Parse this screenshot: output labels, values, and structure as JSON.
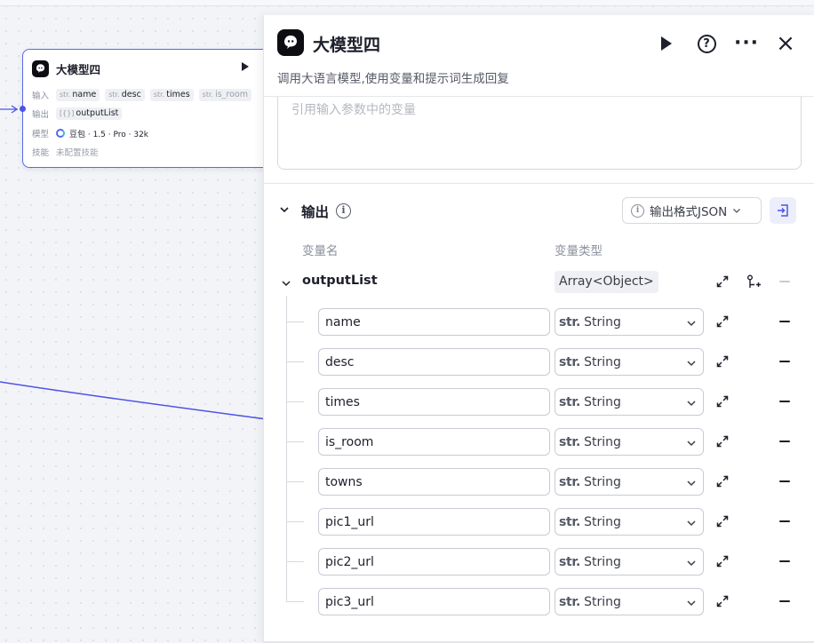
{
  "node": {
    "title": "大模型四",
    "labels": {
      "input": "输入",
      "output": "输出",
      "model": "模型",
      "skill": "技能"
    },
    "inputs": [
      {
        "prefix": "str.",
        "name": "name"
      },
      {
        "prefix": "str.",
        "name": "desc"
      },
      {
        "prefix": "str.",
        "name": "times"
      },
      {
        "prefix": "str.",
        "name": "is_room"
      }
    ],
    "output": {
      "prefix": "[{}]",
      "name": "outputList"
    },
    "model": "豆包 · 1.5 · Pro · 32k",
    "skill": "未配置技能"
  },
  "panel": {
    "title": "大模型四",
    "description": "调用大语言模型,使用变量和提示词生成回复",
    "prompt_placeholder": "引用输入参数中的变量",
    "output": {
      "title": "输出",
      "format_label": "输出格式JSON",
      "col_name": "变量名",
      "col_type": "变量类型",
      "root": {
        "name": "outputList",
        "type": "Array<Object>"
      },
      "fields": [
        {
          "name": "name",
          "type_prefix": "str.",
          "type": "String"
        },
        {
          "name": "desc",
          "type_prefix": "str.",
          "type": "String"
        },
        {
          "name": "times",
          "type_prefix": "str.",
          "type": "String"
        },
        {
          "name": "is_room",
          "type_prefix": "str.",
          "type": "String"
        },
        {
          "name": "towns",
          "type_prefix": "str.",
          "type": "String"
        },
        {
          "name": "pic1_url",
          "type_prefix": "str.",
          "type": "String"
        },
        {
          "name": "pic2_url",
          "type_prefix": "str.",
          "type": "String"
        },
        {
          "name": "pic3_url",
          "type_prefix": "str.",
          "type": "String"
        }
      ]
    }
  },
  "colors": {
    "accent": "#4d53e8",
    "edge": "#4d53e8",
    "border": "#c8cbd3",
    "text": "#1d1f2b"
  },
  "icons": [
    "logo-icon",
    "play-icon",
    "help-icon",
    "more-icon",
    "close-icon",
    "chevron-down-icon",
    "info-icon",
    "import-icon",
    "expand-icon",
    "add-child-icon",
    "minus-icon"
  ]
}
